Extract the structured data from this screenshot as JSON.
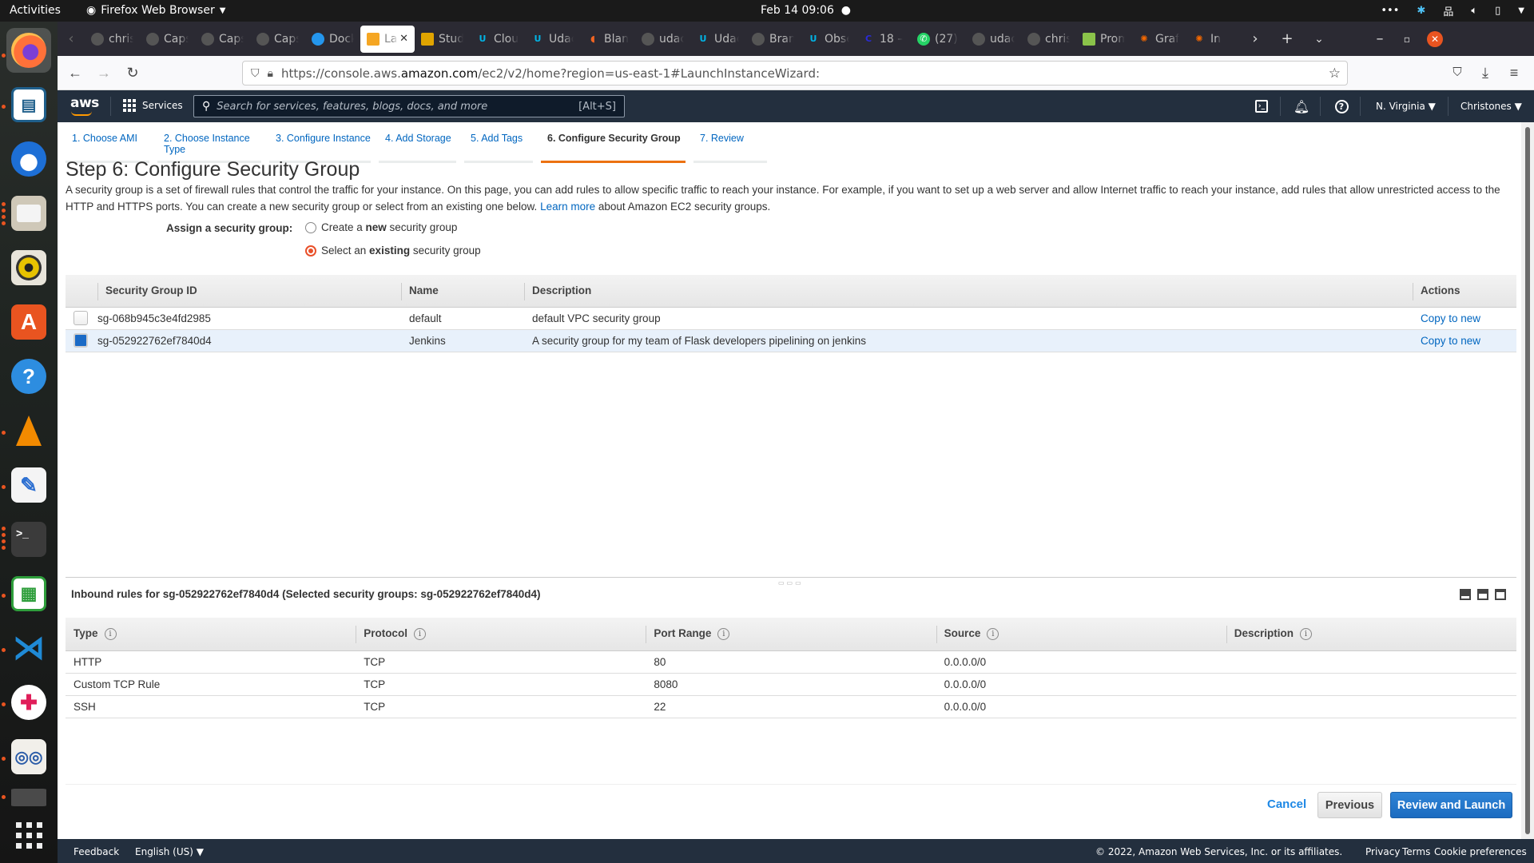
{
  "topbar": {
    "activities": "Activities",
    "app_name": "Firefox Web Browser",
    "clock": "Feb 14  09:06",
    "tray_icons": [
      "more-icon",
      "accessibility-icon",
      "network-icon",
      "volume-icon",
      "battery-icon",
      "system-menu-icon"
    ]
  },
  "dock": {
    "apps": [
      {
        "name": "firefox",
        "running": true
      },
      {
        "name": "libreoffice-impress",
        "running": true
      },
      {
        "name": "thunderbird",
        "running": false
      },
      {
        "name": "files",
        "running": true
      },
      {
        "name": "rhythmbox",
        "running": false
      },
      {
        "name": "software-center",
        "running": false
      },
      {
        "name": "help",
        "running": false
      },
      {
        "name": "vlc",
        "running": true
      },
      {
        "name": "text-editor",
        "running": true
      },
      {
        "name": "terminal",
        "running": true
      },
      {
        "name": "libreoffice-calc",
        "running": true
      },
      {
        "name": "vscode",
        "running": true
      },
      {
        "name": "slack",
        "running": true
      },
      {
        "name": "document-viewer",
        "running": true
      },
      {
        "name": "screenshot",
        "running": true
      }
    ],
    "show_apps": "show-applications-icon"
  },
  "browser": {
    "tabs": [
      {
        "label": "chris",
        "icon": "github"
      },
      {
        "label": "Caps",
        "icon": "github"
      },
      {
        "label": "Caps",
        "icon": "github"
      },
      {
        "label": "Caps",
        "icon": "github"
      },
      {
        "label": "Dock",
        "icon": "docker"
      },
      {
        "label": "Lau",
        "icon": "aws-box",
        "active": true
      },
      {
        "label": "Stud",
        "icon": "student"
      },
      {
        "label": "Clou",
        "icon": "udacity"
      },
      {
        "label": "Udac",
        "icon": "udacity"
      },
      {
        "label": "Blan",
        "icon": "blank"
      },
      {
        "label": "udac",
        "icon": "github"
      },
      {
        "label": "Udac",
        "icon": "udacity"
      },
      {
        "label": "Bran",
        "icon": "github"
      },
      {
        "label": "Obse",
        "icon": "udacity"
      },
      {
        "label": "18 –",
        "icon": "c-logo"
      },
      {
        "label": "(27)",
        "icon": "whatsapp"
      },
      {
        "label": "udac",
        "icon": "github"
      },
      {
        "label": "chris",
        "icon": "github"
      },
      {
        "label": "Prom",
        "icon": "prometheus"
      },
      {
        "label": "Graf",
        "icon": "grafana"
      },
      {
        "label": "In",
        "icon": "grafana"
      }
    ],
    "url_prefix": "https://console.aws.",
    "url_host": "amazon.com",
    "url_path": "/ec2/v2/home?region=us-east-1#LaunchInstanceWizard:"
  },
  "aws": {
    "logo": "aws",
    "services": "Services",
    "search_placeholder": "Search for services, features, blogs, docs, and more",
    "search_shortcut": "[Alt+S]",
    "region": "N. Virginia ▼",
    "account": "Christones ▼"
  },
  "wizard": {
    "steps": [
      {
        "label": "1. Choose AMI"
      },
      {
        "label": "2. Choose Instance Type"
      },
      {
        "label": "3. Configure Instance"
      },
      {
        "label": "4. Add Storage"
      },
      {
        "label": "5. Add Tags"
      },
      {
        "label": "6. Configure Security Group",
        "active": true
      },
      {
        "label": "7. Review"
      }
    ],
    "title": "Step 6: Configure Security Group",
    "intro_1": "A security group is a set of firewall rules that control the traffic for your instance. On this page, you can add rules to allow specific traffic to reach your instance. For example, if you want to set up a web server and allow Internet traffic to reach your instance, add rules that allow unrestricted access to the HTTP and HTTPS ports. You can create a new security group or select from an existing one below.",
    "learn_more": "Learn more",
    "intro_2": "about Amazon EC2 security groups.",
    "assign_label": "Assign a security group:",
    "radio_new": {
      "pre": "Create a ",
      "bold": "new",
      "post": " security group",
      "selected": false
    },
    "radio_existing": {
      "pre": "Select an ",
      "bold": "existing",
      "post": " security group",
      "selected": true
    }
  },
  "sg_table": {
    "headers": [
      "Security Group ID",
      "Name",
      "Description",
      "Actions"
    ],
    "rows": [
      {
        "id": "sg-068b945c3e4fd2985",
        "name": "default",
        "description": "default VPC security group",
        "action": "Copy to new",
        "checked": false
      },
      {
        "id": "sg-052922762ef7840d4",
        "name": "Jenkins",
        "description": "A security group for my team of Flask developers pipelining on jenkins",
        "action": "Copy to new",
        "checked": true
      }
    ]
  },
  "inbound": {
    "title": "Inbound rules for sg-052922762ef7840d4 (Selected security groups: sg-052922762ef7840d4)",
    "headers": [
      "Type",
      "Protocol",
      "Port Range",
      "Source",
      "Description"
    ],
    "rows": [
      {
        "type": "HTTP",
        "protocol": "TCP",
        "port": "80",
        "source": "0.0.0.0/0",
        "description": ""
      },
      {
        "type": "Custom TCP Rule",
        "protocol": "TCP",
        "port": "8080",
        "source": "0.0.0.0/0",
        "description": ""
      },
      {
        "type": "SSH",
        "protocol": "TCP",
        "port": "22",
        "source": "0.0.0.0/0",
        "description": ""
      }
    ]
  },
  "actions": {
    "cancel": "Cancel",
    "previous": "Previous",
    "review_launch": "Review and Launch"
  },
  "footer": {
    "feedback": "Feedback",
    "language": "English (US) ▼",
    "copyright": "© 2022, Amazon Web Services, Inc. or its affiliates.",
    "privacy": "Privacy",
    "terms": "Terms",
    "cookies": "Cookie preferences"
  },
  "colors": {
    "aws_nav": "#232f3e",
    "accent_orange": "#ec7211",
    "link_blue": "#0066c0",
    "primary_button": "#1b6bc0",
    "selected_row": "#e8f1fb"
  }
}
